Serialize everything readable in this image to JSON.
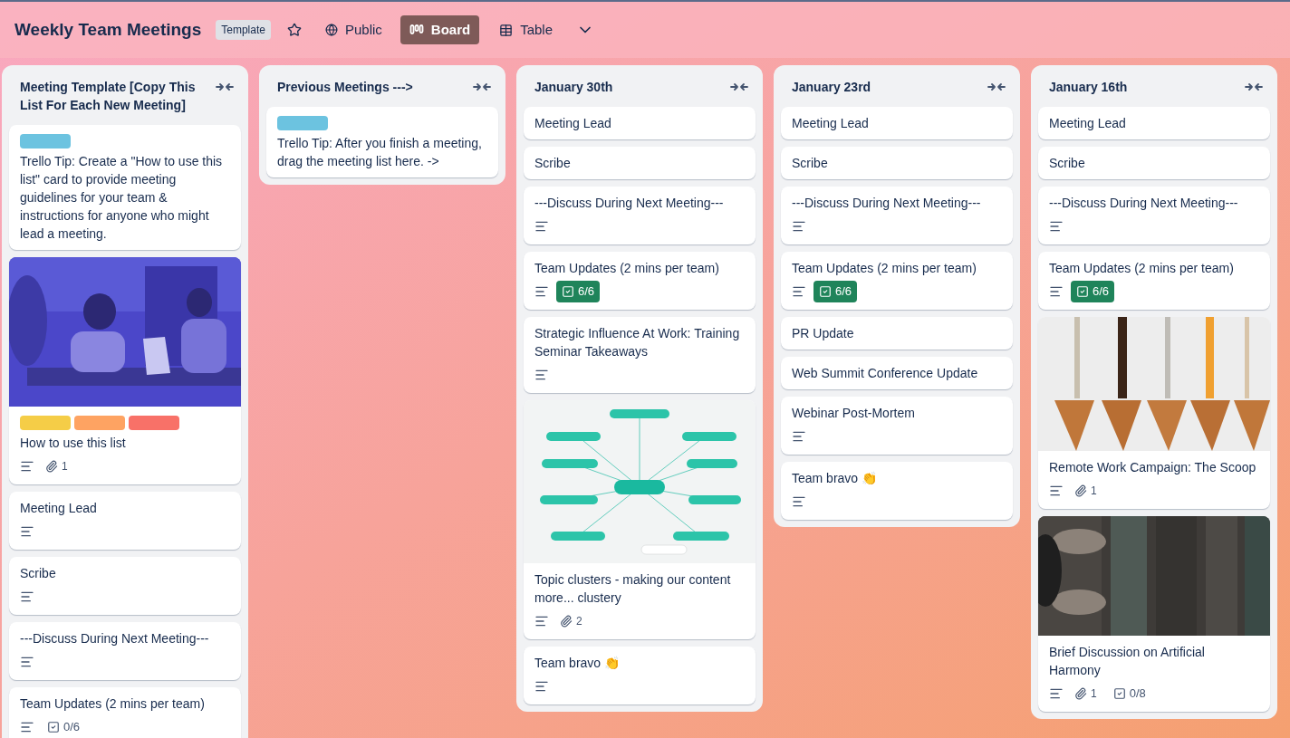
{
  "board": {
    "title": "Weekly Team Meetings",
    "badge": "Template",
    "starred": false,
    "visibility": "Public",
    "views": [
      {
        "label": "Board",
        "kind": "board",
        "selected": true
      },
      {
        "label": "Table",
        "kind": "table",
        "selected": false
      }
    ]
  },
  "lists": [
    {
      "title": "Meeting Template [Copy This List For Each New Meeting]",
      "cards": [
        {
          "title": "Trello Tip: Create a \"How to use this list\" card to provide meeting guidelines for your team & instructions for anyone who might lead a meeting.",
          "labels": [
            {
              "color": "#6cc3e0"
            }
          ]
        },
        {
          "title": "How to use this list",
          "labels": [
            {
              "color": "#f5cd47"
            },
            {
              "color": "#fea362"
            },
            {
              "color": "#f87168"
            }
          ],
          "description": true,
          "attachments": "1"
        },
        {
          "title": "Meeting Lead",
          "description": true
        },
        {
          "title": "Scribe",
          "description": true
        },
        {
          "title": "---Discuss During Next Meeting---",
          "description": true
        },
        {
          "title": "Team Updates (2 mins per team)",
          "description": true,
          "checklist": {
            "text": "0/6",
            "complete": false
          }
        }
      ]
    },
    {
      "title": "Previous Meetings --->",
      "cards": [
        {
          "title": "Trello Tip: After you finish a meeting, drag the meeting list here. ->",
          "labels": [
            {
              "color": "#6cc3e0"
            }
          ]
        }
      ]
    },
    {
      "title": "January 30th",
      "cards": [
        {
          "title": "Meeting Lead"
        },
        {
          "title": "Scribe"
        },
        {
          "title": "---Discuss During Next Meeting---",
          "description": true
        },
        {
          "title": "Team Updates (2 mins per team)",
          "description": true,
          "checklist": {
            "text": "6/6",
            "complete": true
          }
        },
        {
          "title": "Strategic Influence At Work: Training Seminar Takeaways",
          "description": true
        },
        {
          "title": "Topic clusters - making our content more... clustery",
          "description": true,
          "attachments": "2"
        },
        {
          "title": "Team bravo 👏",
          "description": true
        }
      ]
    },
    {
      "title": "January 23rd",
      "cards": [
        {
          "title": "Meeting Lead"
        },
        {
          "title": "Scribe"
        },
        {
          "title": "---Discuss During Next Meeting---",
          "description": true
        },
        {
          "title": "Team Updates (2 mins per team)",
          "description": true,
          "checklist": {
            "text": "6/6",
            "complete": true
          }
        },
        {
          "title": "PR Update"
        },
        {
          "title": "Web Summit Conference Update"
        },
        {
          "title": "Webinar Post-Mortem",
          "description": true
        },
        {
          "title": "Team bravo 👏",
          "description": true
        }
      ]
    },
    {
      "title": "January 16th",
      "cards": [
        {
          "title": "Meeting Lead"
        },
        {
          "title": "Scribe"
        },
        {
          "title": "---Discuss During Next Meeting---",
          "description": true
        },
        {
          "title": "Team Updates (2 mins per team)",
          "description": true,
          "checklist": {
            "text": "6/6",
            "complete": true
          }
        },
        {
          "title": "Remote Work Campaign: The Scoop",
          "description": true,
          "attachments": "1"
        },
        {
          "title": "Brief Discussion on Artificial Harmony",
          "description": true,
          "attachments": "1",
          "checklist": {
            "text": "0/8",
            "complete": false
          }
        }
      ]
    }
  ]
}
